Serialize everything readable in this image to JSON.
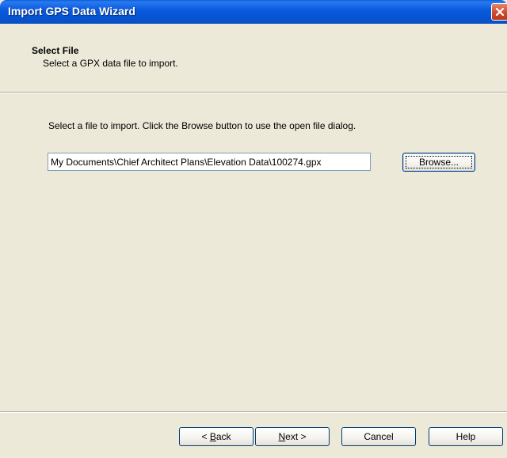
{
  "window": {
    "title": "Import GPS Data Wizard"
  },
  "header": {
    "title": "Select File",
    "subtitle": "Select a GPX data file to import."
  },
  "content": {
    "instructions": "Select a file to import.  Click the Browse button to use the open file dialog.",
    "file_path": "My Documents\\Chief Architect Plans\\Elevation Data\\100274.gpx",
    "browse_label": "Browse..."
  },
  "footer": {
    "back": {
      "prefix": "< ",
      "mnemonic": "B",
      "rest": "ack"
    },
    "next": {
      "mnemonic": "N",
      "rest": "ext >"
    },
    "cancel_label": "Cancel",
    "help_label": "Help"
  },
  "colors": {
    "titlebar": "#0b5be0",
    "dialog_bg": "#ece9d8",
    "close_button": "#c9482a"
  }
}
